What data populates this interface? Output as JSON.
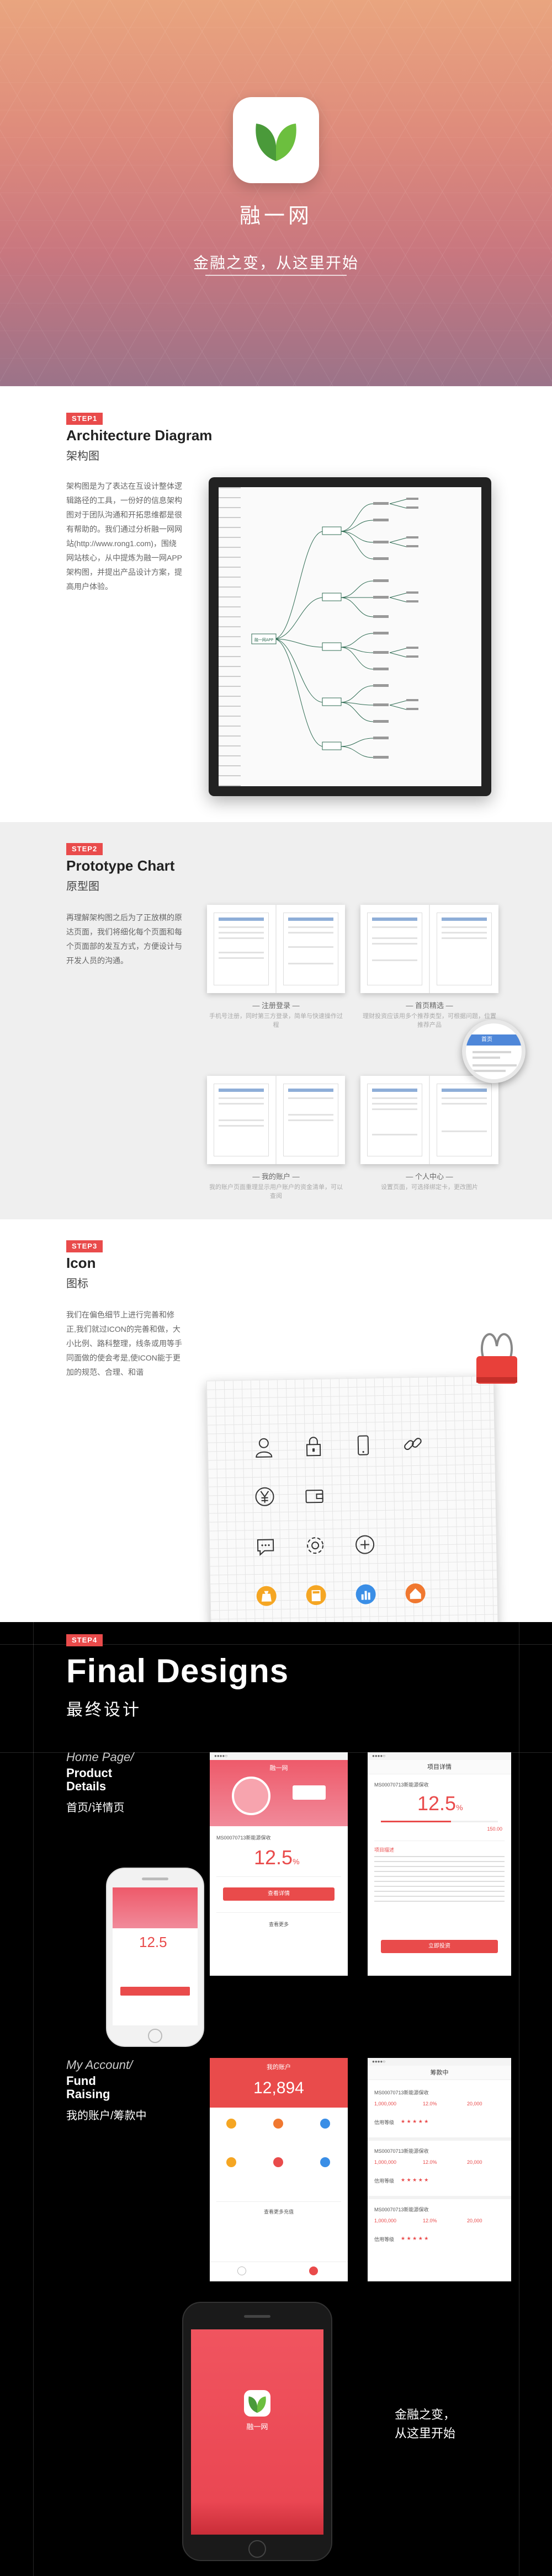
{
  "hero": {
    "brand": "融一网",
    "slogan": "金融之变，从这里开始"
  },
  "steps": {
    "step1": {
      "tag": "STEP1",
      "title": "Architecture Diagram",
      "subtitle": "架构图",
      "desc": "架构图是为了表达在互设计整体逻辑路径的工具，一份好的信息架构图对于团队沟通和开拓思维都是很有帮助的。我们通过分析融一网网站(http://www.rong1.com)，围绕网站核心，从中提炼为融一网APP架构图，并提出产品设计方案，提高用户体验。",
      "mindmap_root": "融一网APP"
    },
    "step2": {
      "tag": "STEP2",
      "title": "Prototype Chart",
      "subtitle": "原型图",
      "desc": "再理解架构图之后为了正放棋的原达页面，我们将细化每个页面和每个页面部的发互方式，方便设计与开发人员的沟通。",
      "cards": [
        {
          "caption": "— 注册登录 —",
          "desc": "手机号注册，同时第三方登录，简单与快速操作过程"
        },
        {
          "caption": "— 首页精选 —",
          "desc": "理财投资应该用多个推荐类型，可根据问题，位置推荐产品"
        },
        {
          "caption": "— 我的账户 —",
          "desc": "我的账户页面重理显示用户账户的资金清单，可以查阅"
        },
        {
          "caption": "— 个人中心 —",
          "desc": "设置页面，可选择绑定卡，更改图片"
        }
      ],
      "magnifier_label": "首页"
    },
    "step3": {
      "tag": "STEP3",
      "title": "Icon",
      "subtitle": "图标",
      "desc": "我们在偏色细节上进行完善和修正,我们就过ICON的完善和做，大小比例、路科整理，线条或用等手同面做的使会考是,使ICON能于更加的规范、合理、和谐"
    },
    "step4": {
      "tag": "STEP4",
      "title": "Final Designs",
      "subtitle": "最终设计",
      "group1": {
        "en1": "Home Page/",
        "en2": "Product",
        "en3": "Details",
        "cn": "首页/详情页"
      },
      "group2": {
        "en1": "My Account/",
        "en2": "Fund",
        "en3": "Raising",
        "cn": "我的账户/筹款中"
      }
    }
  },
  "screens": {
    "home": {
      "nav": "融一网",
      "product": "MS00070713新能源保收",
      "rate": "12.5",
      "rate_unit": "%",
      "btn_detail": "查看详情",
      "btn_more": "查看更多"
    },
    "detail": {
      "nav": "项目详情",
      "product": "MS00070713新能源保收",
      "rate": "12.5",
      "rate_unit": "%",
      "amount": "150.00",
      "section": "项目描述",
      "btn_invest": "立即投资"
    },
    "account": {
      "nav": "我的账户",
      "balance": "12,894",
      "btn_more": "查看更多充值"
    },
    "raising": {
      "nav": "筹款中",
      "rows": [
        {
          "name": "MS00070713新能源保收",
          "amount": "1,000,000",
          "rate": "12.0%",
          "min": "20,000"
        },
        {
          "name": "MS00070713新能源保收",
          "amount": "1,000,000",
          "rate": "12.0%",
          "min": "20,000"
        },
        {
          "name": "MS00070713新能源保收",
          "amount": "1,000,000",
          "rate": "12.0%",
          "min": "20,000"
        }
      ],
      "stars_label": "信用等级"
    },
    "splash": {
      "brand": "融一网",
      "line1": "金融之变，",
      "line2": "从这里开始"
    }
  }
}
